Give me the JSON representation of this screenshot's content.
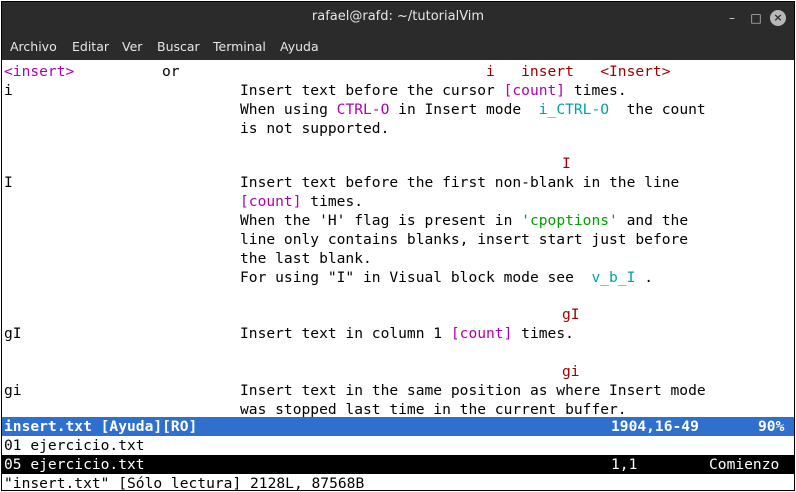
{
  "window": {
    "title": "rafael@rafd: ~/tutorialVim",
    "controls": {
      "minimize": "–",
      "maximize": "□",
      "close": "×"
    }
  },
  "menu": [
    "Archivo",
    "Editar",
    "Ver",
    "Buscar",
    "Terminal",
    "Ayuda"
  ],
  "help": {
    "l1_a": "<insert>",
    "l1_b": "or",
    "l1_c": "i   insert   <Insert>",
    "l2_key": "i",
    "l2_t1": "Insert text before the cursor ",
    "l2_count": "[count]",
    "l2_t2": " times.",
    "l3_t1": "When using ",
    "l3_ctrl": "CTRL-O",
    "l3_t2": " in Insert mode ",
    "l3_link": " i_CTRL-O ",
    "l3_t3": " the count",
    "l4": "is not supported.",
    "tag_I": "I",
    "l6_key": "I",
    "l6_t1": "Insert text before the first non-blank in the line",
    "l7_count": "[count]",
    "l7_t2": " times.",
    "l8_t1": "When the 'H' flag is present in ",
    "l8_opt": "'cpoptions'",
    "l8_t2": " and the",
    "l9": "line only contains blanks, insert start just before",
    "l10": "the last blank.",
    "l11_t1": "For using \"I\" in Visual block mode see ",
    "l11_link": " v_b_I ",
    "l11_t2": ".",
    "tag_gI": "gI",
    "l13_key": "gI",
    "l13_t1": "Insert text in column 1 ",
    "l13_count": "[count]",
    "l13_t2": " times.",
    "tag_gi": "gi",
    "l15_key": "gi",
    "l15_t1": "Insert text in the same position as where Insert mode",
    "l16": "was stopped last time in the current buffer."
  },
  "status_active": {
    "file": "insert.txt [Ayuda][RO]",
    "pos": "1904,16-49",
    "pct": "90%"
  },
  "buffer2": {
    "line": "01 ejercicio.txt"
  },
  "status_inactive": {
    "file": "05 ejercicio.txt",
    "pos": "1,1",
    "pct": "Comienzo"
  },
  "cmdline": "\"insert.txt\" [Sólo lectura] 2128L, 87568B"
}
